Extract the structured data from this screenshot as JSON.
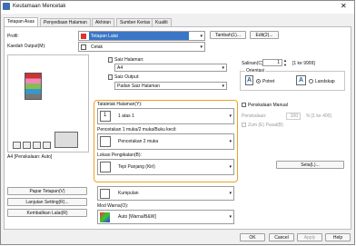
{
  "window": {
    "title": "Keutamaan Mencetak",
    "close_glyph": "✕"
  },
  "tabs": [
    {
      "label": "Tetapan Asas"
    },
    {
      "label": "Penyediaan Halaman"
    },
    {
      "label": "Akhiran"
    },
    {
      "label": "Sumber Kertas"
    },
    {
      "label": "Kualiti"
    }
  ],
  "profile": {
    "label": "Profil:",
    "value": "Tetapan Lalai",
    "add_button": "Tambah(1)...",
    "edit_button": "Edit(2)..."
  },
  "output": {
    "label": "Kaedah Output(M):",
    "value": "Cetak"
  },
  "page_size": {
    "label": "Saiz Halaman:",
    "value": "A4"
  },
  "output_size": {
    "label": "Saiz Output:",
    "value": "Padan Saiz Halaman"
  },
  "copies": {
    "label": "Salinan(C):",
    "value": "1",
    "range": "[1 ke 9999]"
  },
  "orientation": {
    "label": "Orientasi",
    "portrait": "Potret",
    "landscape": "Landskap"
  },
  "preview": {
    "label": "A4 [Penskalaan: Auto]"
  },
  "layout": {
    "label": "Tataletak Halaman(Y):",
    "value": "1 atas 1"
  },
  "duplex": {
    "label": "Pencetakan 1 muka/2 muka/Buku kecil:",
    "value": "Pencetakan 2 muka"
  },
  "binding": {
    "label": "Lokasi Pengikatan(B):",
    "value": "Tepi Panjang (Kiri)"
  },
  "manual_scaling": {
    "label": "Penskalaan Manual",
    "scale_label": "Penskalaan:",
    "scale_value": "100",
    "scale_range": "% [1 ke 400]",
    "auto_reset": "Zum (E) Pusat(B)"
  },
  "finishing": {
    "value": "Kumpulan"
  },
  "color_mode": {
    "label": "Mod Warna(O):",
    "value": "Auto [Warna/B&W]"
  },
  "side_buttons": {
    "settings": "Seta(L)...",
    "page_settings": "Papar Tetapan(V)",
    "trapping": "Lanjutan Setting(R)...",
    "restore": "Kembalikan Lalai(R)"
  },
  "footer": {
    "ok": "OK",
    "cancel": "Cancel",
    "apply": "Apply",
    "help": "Help"
  }
}
